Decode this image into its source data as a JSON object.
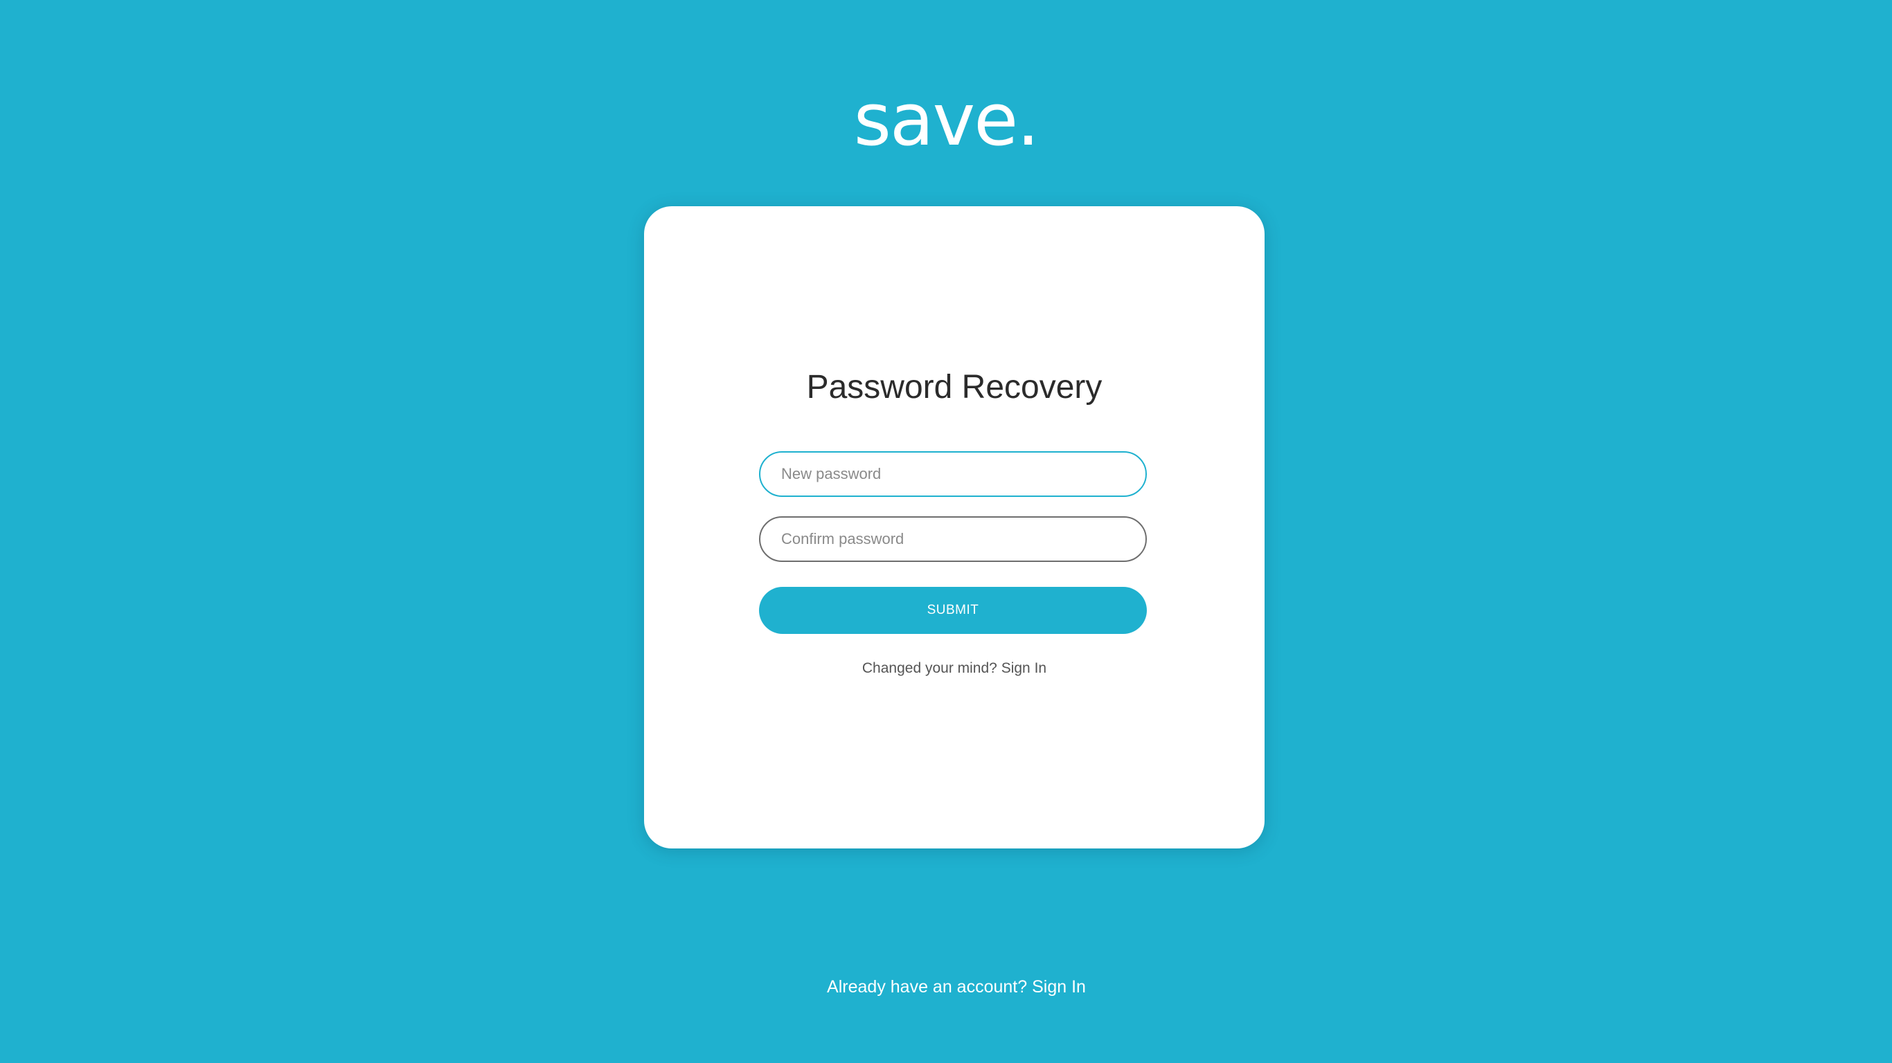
{
  "brand": {
    "logo_text": "save.",
    "background_color": "#1fb1cf",
    "accent_color": "#1fb1cf"
  },
  "card": {
    "title": "Password Recovery",
    "new_password": {
      "value": "",
      "placeholder": "New password"
    },
    "confirm_password": {
      "value": "",
      "placeholder": "Confirm password"
    },
    "submit_label": "SUBMIT",
    "footer_prompt": "Changed your mind?",
    "footer_link": "Sign In"
  },
  "page_footer": {
    "prompt": "Already have an account?",
    "link": "Sign In"
  }
}
